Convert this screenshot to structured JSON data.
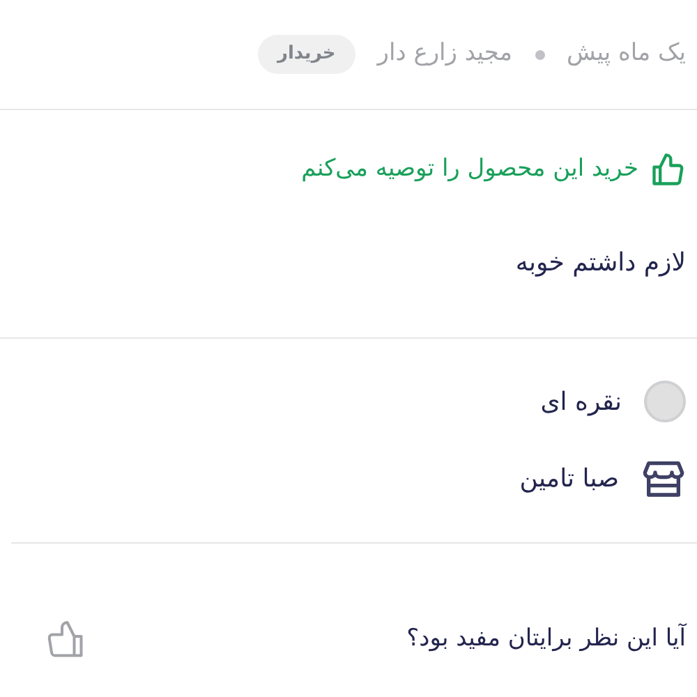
{
  "meta": {
    "time": "یک ماه پیش",
    "author": "مجید زارع دار",
    "badge": "خریدار"
  },
  "recommendation": {
    "recommended": true,
    "text": "خرید این محصول را توصیه می‌کنم"
  },
  "comment": "لازم داشتم خوبه",
  "variant": {
    "name": "نقره ای",
    "color": "#e0e0e0"
  },
  "seller": {
    "name": "صبا تامین"
  },
  "helpful": {
    "question": "آیا این نظر برایتان مفید بود؟"
  }
}
